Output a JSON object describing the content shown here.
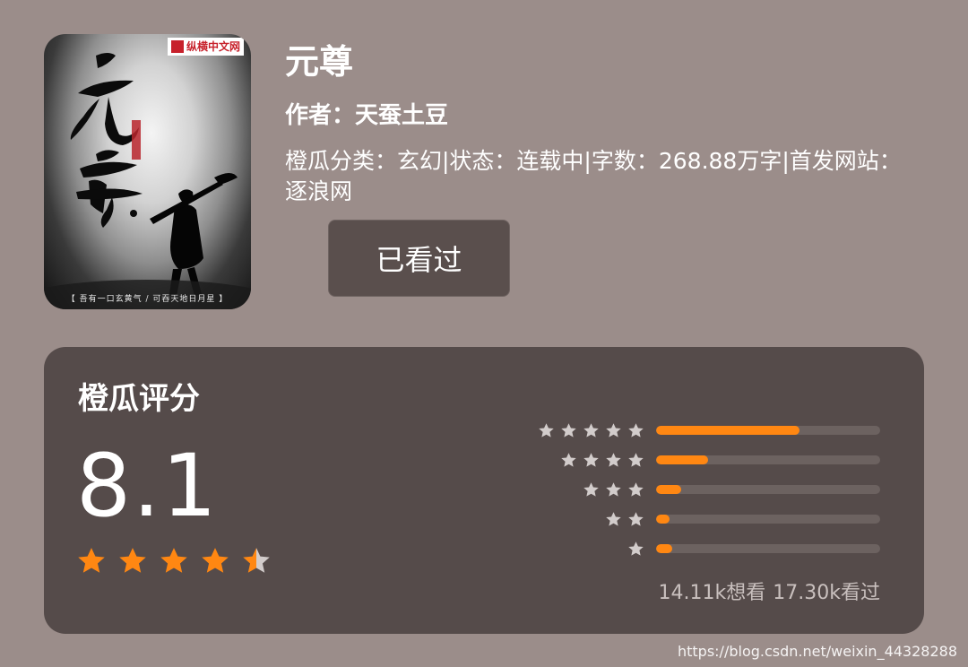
{
  "book": {
    "title": "元尊",
    "author": "作者：天蚕土豆",
    "meta": "橙瓜分类：玄幻|状态：连载中|字数：268.88万字|首发网站：逐浪网",
    "read_button_label": "已看过",
    "cover": {
      "title_text": "元尊",
      "publisher_logo": "纵横中文网",
      "tagline": "【 吾有一口玄黄气 / 可吞天地日月星 】"
    }
  },
  "rating": {
    "heading": "橙瓜评分",
    "score": "8.1",
    "score_stars": 4.5,
    "distribution": [
      {
        "stars": 5,
        "fraction": 0.64
      },
      {
        "stars": 4,
        "fraction": 0.23
      },
      {
        "stars": 3,
        "fraction": 0.11
      },
      {
        "stars": 2,
        "fraction": 0.06
      },
      {
        "stars": 1,
        "fraction": 0.07
      }
    ],
    "want_count": "14.11k想看",
    "read_count": "17.30k看过"
  },
  "watermark": "https://blog.csdn.net/weixin_44328288",
  "colors": {
    "background": "#9b8d8a",
    "card": "#554b4a",
    "accent": "#ff8712",
    "track": "#6c6260",
    "button": "#5a4f4d",
    "star_gray": "#d2cccb"
  },
  "icons": {
    "rating_star": "star-icon",
    "distribution_star": "small-star-icon"
  }
}
